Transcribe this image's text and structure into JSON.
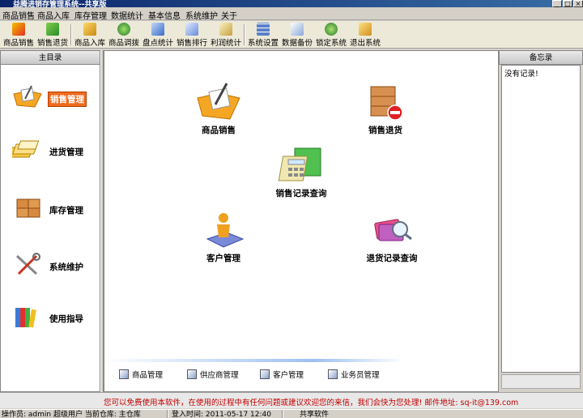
{
  "window": {
    "title": "益腾进销存管理系统--共享版"
  },
  "menu": [
    {
      "label": "商品销售"
    },
    {
      "label": "商品入库"
    },
    {
      "label": "库存管理"
    },
    {
      "label": "数据统计"
    },
    {
      "label": "基本信息"
    },
    {
      "label": "系统维护"
    },
    {
      "label": "关于"
    }
  ],
  "toolbar": [
    {
      "label": "商品销售",
      "icon": "sell-icon"
    },
    {
      "label": "销售退货",
      "icon": "return-icon"
    },
    {
      "label": "商品入库",
      "icon": "stock-in-icon"
    },
    {
      "label": "商品调拨",
      "icon": "transfer-icon"
    },
    {
      "label": "盘点统计",
      "icon": "inventory-icon"
    },
    {
      "label": "销售排行",
      "icon": "ranking-icon"
    },
    {
      "label": "利润统计",
      "icon": "profit-icon"
    },
    {
      "label": "系统设置",
      "icon": "settings-icon"
    },
    {
      "label": "数据备份",
      "icon": "backup-icon"
    },
    {
      "label": "锁定系统",
      "icon": "lock-icon"
    },
    {
      "label": "退出系统",
      "icon": "exit-icon"
    }
  ],
  "left_panel": {
    "title": "主目录",
    "items": [
      {
        "label": "销售管理",
        "active": true
      },
      {
        "label": "进货管理",
        "active": false
      },
      {
        "label": "库存管理",
        "active": false
      },
      {
        "label": "系统维护",
        "active": false
      },
      {
        "label": "使用指导",
        "active": false
      }
    ]
  },
  "main": {
    "features": [
      {
        "label": "商品销售"
      },
      {
        "label": "销售退货"
      },
      {
        "label": "销售记录查询"
      },
      {
        "label": "客户管理"
      },
      {
        "label": "退货记录查询"
      }
    ],
    "quick_links": [
      {
        "label": "商品管理"
      },
      {
        "label": "供应商管理"
      },
      {
        "label": "客户管理"
      },
      {
        "label": "业务员管理"
      }
    ]
  },
  "right_panel": {
    "title": "备忘录",
    "content": "没有记录!"
  },
  "notice": "您可以免费使用本软件，在使用的过程中有任何问题或建议欢迎您的来信，我们会快为您处理! 邮件地址: sq-it@139.com",
  "status": {
    "operator": "操作员: admin 超级用户 当前仓库: 主仓库",
    "login_time": "登入时间: 2011-05-17 12:40",
    "edition": "共享软件"
  }
}
